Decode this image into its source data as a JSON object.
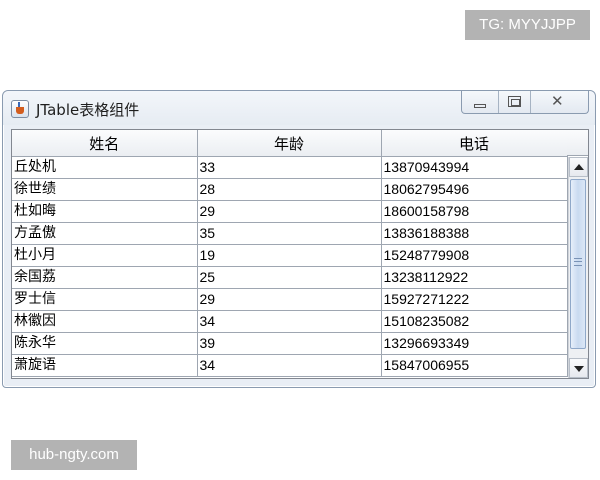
{
  "watermarks": {
    "top": "TG: MYYJJPP",
    "bottom": "hub-ngty.com"
  },
  "window": {
    "title": "JTable表格组件",
    "icon": "java-cup-icon"
  },
  "table": {
    "headers": [
      "姓名",
      "年龄",
      "电话"
    ],
    "rows": [
      [
        "丘处机",
        "33",
        "13870943994"
      ],
      [
        "徐世绩",
        "28",
        "18062795496"
      ],
      [
        "杜如晦",
        "29",
        "18600158798"
      ],
      [
        "方孟傲",
        "35",
        "13836188388"
      ],
      [
        "杜小月",
        "19",
        "15248779908"
      ],
      [
        "余国荔",
        "25",
        "13238112922"
      ],
      [
        "罗士信",
        "29",
        "15927271222"
      ],
      [
        "林徽因",
        "34",
        "15108235082"
      ],
      [
        "陈永华",
        "39",
        "13296693349"
      ],
      [
        "萧旋语",
        "34",
        "15847006955"
      ]
    ]
  },
  "scrollbar": {
    "position": 0.0
  }
}
